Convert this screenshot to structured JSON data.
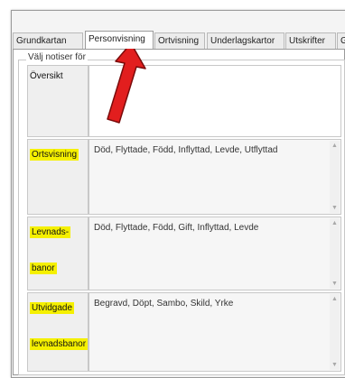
{
  "tabs": [
    {
      "label": "Grundkartan"
    },
    {
      "label": "Personvisning"
    },
    {
      "label": "Ortvisning"
    },
    {
      "label": "Underlagskartor"
    },
    {
      "label": "Utskrifter"
    },
    {
      "label": "G"
    }
  ],
  "active_tab": "Personvisning",
  "group_label": "Välj notiser för",
  "rows": [
    {
      "header": "Översikt",
      "value": ""
    },
    {
      "header": "Ortsvisning",
      "value": "Död, Flyttade, Född, Inflyttad, Levde, Utflyttad"
    },
    {
      "header_line1": "Levnads-",
      "header_line2": "banor",
      "value": "Död, Flyttade, Född, Gift, Inflyttad, Levde"
    },
    {
      "header_line1": "Utvidgade",
      "header_line2": "levnadsbanor",
      "value": "Begravd, Döpt, Sambo, Skild, Yrke"
    }
  ],
  "colors": {
    "highlight": "#f5f000",
    "arrow": "#e21e1e"
  }
}
